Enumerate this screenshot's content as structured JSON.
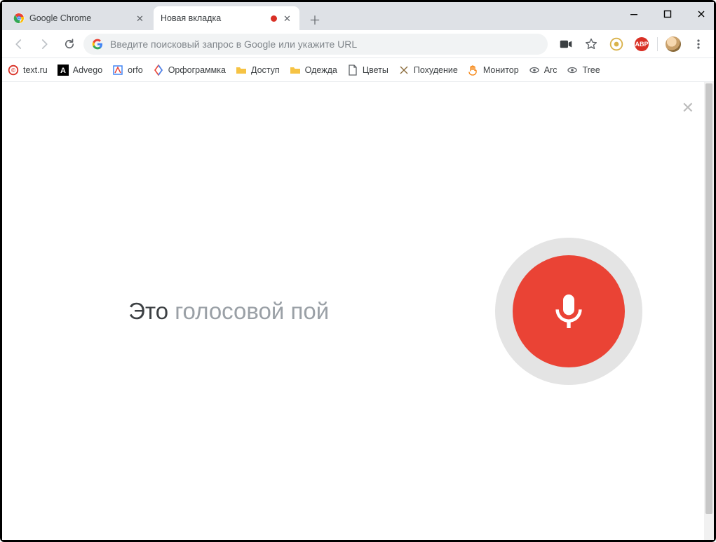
{
  "tabs": [
    {
      "title": "Google Chrome"
    },
    {
      "title": "Новая вкладка"
    }
  ],
  "omnibox": {
    "placeholder": "Введите поисковый запрос в Google или укажите URL"
  },
  "toolbar": {
    "abp_label": "ABP"
  },
  "bookmarks": [
    {
      "label": "text.ru"
    },
    {
      "label": "Advego"
    },
    {
      "label": "orfo"
    },
    {
      "label": "Орфограммка"
    },
    {
      "label": "Доступ"
    },
    {
      "label": "Одежда"
    },
    {
      "label": "Цветы"
    },
    {
      "label": "Похудение"
    },
    {
      "label": "Монитор"
    },
    {
      "label": "Arc"
    },
    {
      "label": "Tree"
    }
  ],
  "voice": {
    "text_strong": "Это ",
    "text_faded": "голосовой пой"
  }
}
